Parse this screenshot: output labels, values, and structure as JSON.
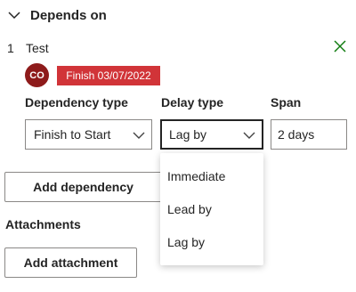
{
  "section": {
    "title": "Depends on"
  },
  "dependency": {
    "index": "1",
    "name": "Test",
    "avatar_initials": "CO",
    "finish_badge": "Finish 03/07/2022"
  },
  "fields": {
    "dependency_type": {
      "label": "Dependency type",
      "value": "Finish to Start"
    },
    "delay_type": {
      "label": "Delay type",
      "value": "Lag by"
    },
    "span": {
      "label": "Span",
      "value": "2 days"
    }
  },
  "dropdown": {
    "options": [
      "Immediate",
      "Lead by",
      "Lag by"
    ]
  },
  "buttons": {
    "add_dependency": "Add dependency",
    "add_attachment": "Add attachment"
  },
  "attachments": {
    "title": "Attachments"
  },
  "colors": {
    "badge_red": "#d13438",
    "avatar_red": "#8e1b1b",
    "close_green": "#107c10"
  }
}
